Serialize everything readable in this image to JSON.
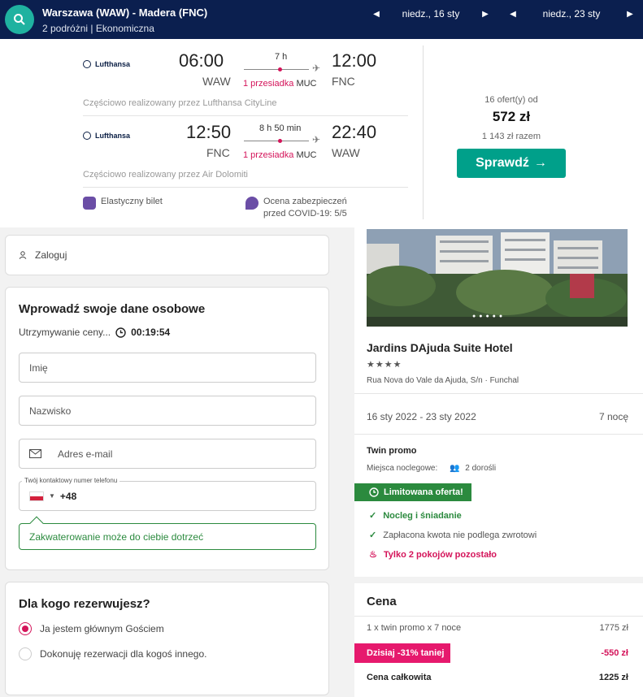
{
  "search": {
    "route": "Warszawa (WAW) - Madera (FNC)",
    "passengers": "2 podróżni",
    "cabin": "Ekonomiczna",
    "outbound_date": "niedz., 16 sty",
    "return_date": "niedz., 23 sty"
  },
  "flight": {
    "legs": [
      {
        "airline": "Lufthansa",
        "dep_time": "06:00",
        "dep_code": "WAW",
        "duration": "7 h",
        "stops": "1 przesiadka",
        "via": "MUC",
        "arr_time": "12:00",
        "arr_code": "FNC",
        "operated_by": "Częściowo realizowany przez Lufthansa CityLine"
      },
      {
        "airline": "Lufthansa",
        "dep_time": "12:50",
        "dep_code": "FNC",
        "duration": "8 h 50 min",
        "stops": "1 przesiadka",
        "via": "MUC",
        "arr_time": "22:40",
        "arr_code": "WAW",
        "operated_by": "Częściowo realizowany przez Air Dolomiti"
      }
    ],
    "features": [
      "Elastyczny bilet",
      "Ocena zabezpieczeń",
      "przed COVID-19: 5/5"
    ],
    "offers": "16 ofert(y) od",
    "price": "572 zł",
    "total": "1 143 zł razem",
    "cta": "Sprawdź"
  },
  "login": {
    "label": "Zaloguj"
  },
  "form": {
    "title": "Wprowadź swoje dane osobowe",
    "hold_text": "Utrzymywanie ceny...",
    "timer": "00:19:54",
    "first_name_placeholder": "Imię",
    "last_name_placeholder": "Nazwisko",
    "email_placeholder": "Adres e-mail",
    "phone_label": "Twój kontaktowy numer telefonu",
    "phone_prefix": "+48",
    "tip": "Zakwaterowanie może do ciebie dotrzeć"
  },
  "booking_for": {
    "title": "Dla kogo rezerwujesz?",
    "option_self": "Ja jestem głównym Gościem",
    "option_other": "Dokonuję rezerwacji dla kogoś innego."
  },
  "hotel": {
    "name": "Jardins DAjuda Suite Hotel",
    "stars": "★★★★",
    "address": "Rua Nova do Vale da Ajuda, S/n · Funchal",
    "dates": "16 sty 2022 - 23 sty 2022",
    "nights": "7 nocę",
    "room": "Twin promo",
    "beds_label": "Miejsca noclegowe:",
    "beds_value": "2 dorośli",
    "limited": "Limitowana oferta!",
    "perk_breakfast": "Nocleg i śniadanie",
    "perk_refund": "Zapłacona kwota nie podlega zwrotowi",
    "perk_rooms": "Tylko 2 pokojów pozostało"
  },
  "price_summary": {
    "title": "Cena",
    "line_label": "1 x twin promo x 7 noce",
    "line_value": "1775 zł",
    "discount_label": "Dzisiaj -31% taniej",
    "discount_value": "-550 zł",
    "total_label": "Cena całkowita",
    "total_value": "1225 zł"
  },
  "colors": {
    "navy": "#0b1f4f",
    "teal": "#00a08a",
    "accent": "#d4145a",
    "green": "#2b8a3e"
  }
}
